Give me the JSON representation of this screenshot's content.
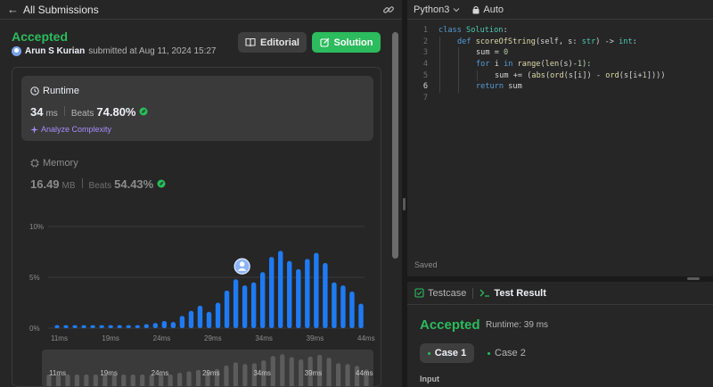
{
  "left_header": {
    "title": "All Submissions"
  },
  "submission": {
    "status": "Accepted",
    "user": "Arun S Kurian",
    "submitted_text": "submitted at Aug 11, 2024 15:27",
    "editorial_label": "Editorial",
    "solution_label": "Solution"
  },
  "runtime": {
    "label": "Runtime",
    "value": "34",
    "unit": "ms",
    "beats_label": "Beats",
    "beats": "74.80%",
    "analyze_label": "Analyze Complexity"
  },
  "memory": {
    "label": "Memory",
    "value": "16.49",
    "unit": "MB",
    "beats_label": "Beats",
    "beats": "54.43%"
  },
  "chart_data": {
    "type": "bar",
    "y_ticks": [
      "10%",
      "5%",
      "0%"
    ],
    "ylim": [
      0,
      10
    ],
    "x_tick_labels": [
      "11ms",
      "19ms",
      "24ms",
      "29ms",
      "34ms",
      "39ms",
      "44ms"
    ],
    "values": [
      0.3,
      0.3,
      0.3,
      0.3,
      0.3,
      0.3,
      0.3,
      0.3,
      0.3,
      0.3,
      0.4,
      0.5,
      0.7,
      0.6,
      1.2,
      1.7,
      2.2,
      1.6,
      2.5,
      3.7,
      4.8,
      4.2,
      4.5,
      5.5,
      7.0,
      7.6,
      6.6,
      5.8,
      6.8,
      7.4,
      6.4,
      4.5,
      4.2,
      3.6,
      2.4
    ],
    "highlight_index": 22,
    "bar_color": "#1e7bf4"
  },
  "mini_chart": {
    "x_tick_labels": [
      "11ms",
      "19ms",
      "24ms",
      "29ms",
      "34ms",
      "39ms",
      "44ms"
    ],
    "values": [
      0.3,
      0.3,
      0.3,
      0.3,
      0.3,
      0.3,
      0.3,
      0.3,
      0.3,
      0.3,
      0.4,
      0.5,
      0.7,
      0.6,
      1.2,
      1.7,
      2.2,
      1.6,
      2.5,
      3.7,
      4.8,
      4.2,
      4.5,
      5.5,
      7.0,
      7.6,
      6.6,
      5.8,
      6.8,
      7.4,
      6.4,
      4.5,
      4.2,
      3.6,
      2.4
    ]
  },
  "editor": {
    "language": "Python3",
    "mode": "Auto",
    "saved_label": "Saved",
    "active_line": 6,
    "lines": [
      {
        "n": "1",
        "indent": 0,
        "tokens": [
          [
            "kw",
            "class "
          ],
          [
            "ty",
            "Solution"
          ],
          [
            "tx",
            ":"
          ]
        ]
      },
      {
        "n": "2",
        "indent": 1,
        "tokens": [
          [
            "kw",
            "def "
          ],
          [
            "fn",
            "scoreOfString"
          ],
          [
            "tx",
            "(self, s: "
          ],
          [
            "ty",
            "str"
          ],
          [
            "tx",
            ") -> "
          ],
          [
            "ty",
            "int"
          ],
          [
            "tx",
            ":"
          ]
        ]
      },
      {
        "n": "3",
        "indent": 2,
        "tokens": [
          [
            "tx",
            "sum = "
          ],
          [
            "nm",
            "0"
          ]
        ]
      },
      {
        "n": "4",
        "indent": 2,
        "tokens": [
          [
            "kw",
            "for "
          ],
          [
            "tx",
            "i "
          ],
          [
            "kw",
            "in "
          ],
          [
            "fn",
            "range"
          ],
          [
            "tx",
            "("
          ],
          [
            "fn",
            "len"
          ],
          [
            "tx",
            "(s)-"
          ],
          [
            "nm",
            "1"
          ],
          [
            "tx",
            "):"
          ]
        ]
      },
      {
        "n": "5",
        "indent": 3,
        "tokens": [
          [
            "tx",
            "sum += ("
          ],
          [
            "fn",
            "abs"
          ],
          [
            "tx",
            "("
          ],
          [
            "fn",
            "ord"
          ],
          [
            "tx",
            "(s[i]) - "
          ],
          [
            "fn",
            "ord"
          ],
          [
            "tx",
            "(s[i+"
          ],
          [
            "nm",
            "1"
          ],
          [
            "tx",
            "])))"
          ]
        ]
      },
      {
        "n": "6",
        "indent": 2,
        "tokens": [
          [
            "kw",
            "return "
          ],
          [
            "tx",
            "sum"
          ]
        ]
      },
      {
        "n": "7",
        "indent": 0,
        "tokens": []
      }
    ]
  },
  "tests": {
    "testcase_tab": "Testcase",
    "result_tab": "Test Result",
    "status": "Accepted",
    "runtime_text": "Runtime: 39 ms",
    "cases": [
      "Case 1",
      "Case 2"
    ],
    "input_label": "Input"
  },
  "colors": {
    "accent_green": "#2cbb5d",
    "bar_blue": "#1e7bf4",
    "panel_bg": "#262626"
  }
}
